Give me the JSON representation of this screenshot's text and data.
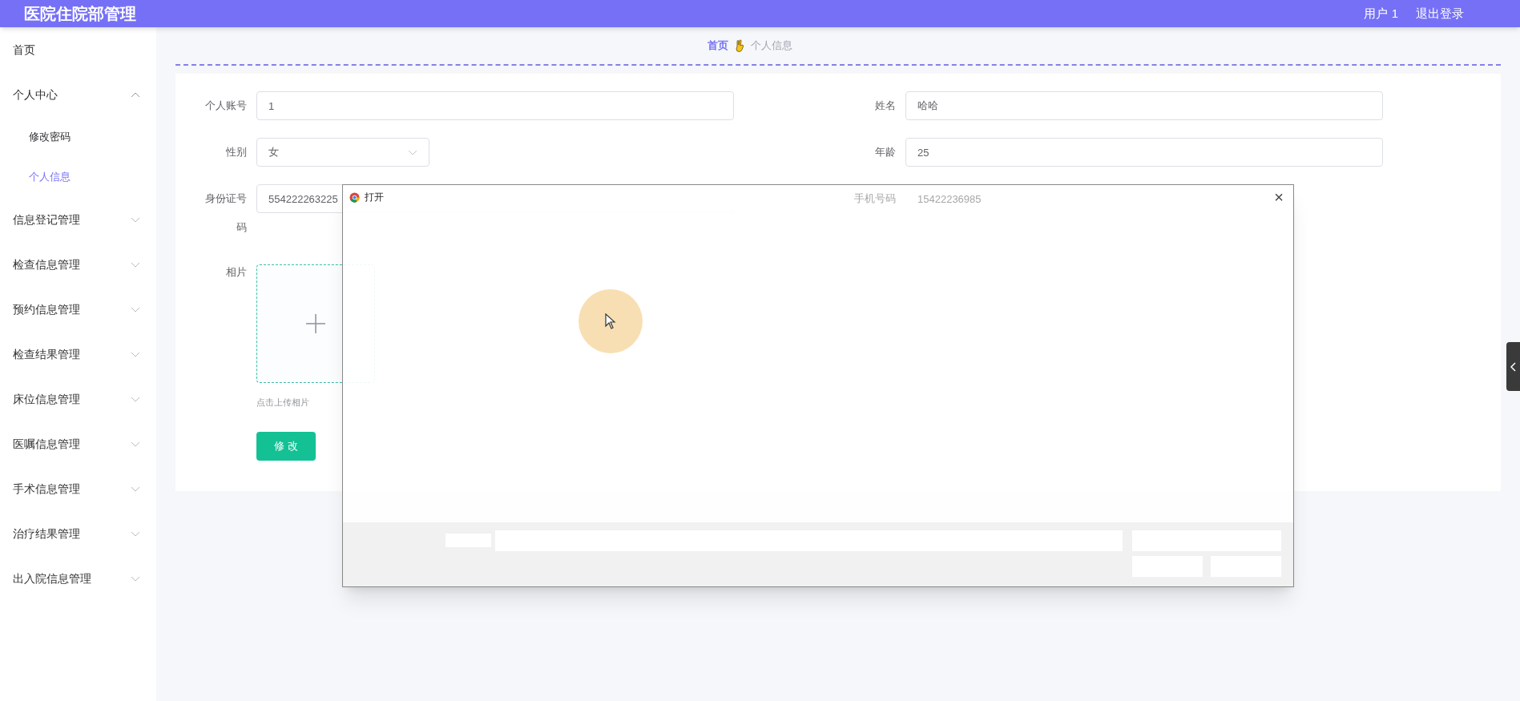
{
  "header": {
    "title": "医院住院部管理",
    "user": "用户 1",
    "logout": "退出登录"
  },
  "sidebar": {
    "items": [
      {
        "label": "首页",
        "selected": false
      },
      {
        "label": "个人中心",
        "expanded": true,
        "selected": false,
        "children": [
          {
            "label": "修改密码",
            "selected": false
          },
          {
            "label": "个人信息",
            "selected": true
          }
        ]
      },
      {
        "label": "信息登记管理",
        "expanded": false,
        "selected": false
      },
      {
        "label": "检查信息管理",
        "expanded": false,
        "selected": false
      },
      {
        "label": "预约信息管理",
        "expanded": false,
        "selected": false
      },
      {
        "label": "检查结果管理",
        "expanded": false,
        "selected": false
      },
      {
        "label": "床位信息管理",
        "expanded": false,
        "selected": false
      },
      {
        "label": "医嘱信息管理",
        "expanded": false,
        "selected": false
      },
      {
        "label": "手术信息管理",
        "expanded": false,
        "selected": false
      },
      {
        "label": "治疗结果管理",
        "expanded": false,
        "selected": false
      },
      {
        "label": "出入院信息管理",
        "expanded": false,
        "selected": false
      }
    ]
  },
  "breadcrumb": {
    "home": "首页",
    "current": "个人信息"
  },
  "form": {
    "fields": [
      {
        "label": "个人账号",
        "value": "1",
        "kind": "input"
      },
      {
        "label": "姓名",
        "value": "哈哈",
        "kind": "input"
      },
      {
        "label": "性别",
        "value": "女",
        "kind": "select"
      },
      {
        "label": "年龄",
        "value": "25",
        "kind": "input"
      },
      {
        "label": "身份证号码",
        "value": "554222263225",
        "kind": "input"
      },
      {
        "label": "手机号码",
        "value": "15422236985",
        "kind": "input"
      }
    ],
    "photo_label": "相片",
    "upload_hint": "点击上传相片",
    "submit": "修 改"
  },
  "dialog": {
    "title": "打开",
    "close": "×"
  }
}
